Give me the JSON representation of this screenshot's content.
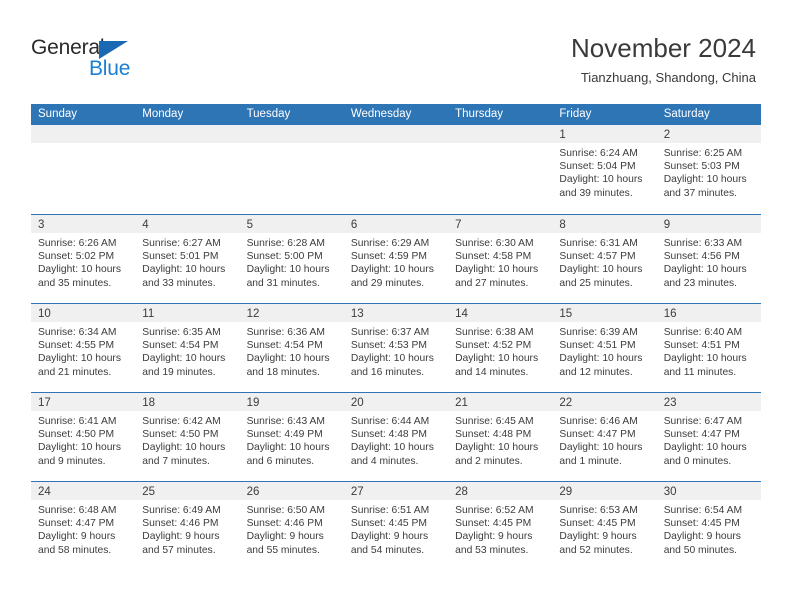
{
  "brand": {
    "name_part1": "General",
    "name_part2": "Blue",
    "triangle_color": "#1b68b3",
    "blue_color": "#1b7fd4"
  },
  "header": {
    "title": "November 2024",
    "subtitle": "Tianzhuang, Shandong, China"
  },
  "theme": {
    "header_row_bg": "#2e75b6",
    "day_band_bg": "#f0f0f0",
    "row_divider": "#2e75b6",
    "text": "#3c3c3c"
  },
  "weekdays": [
    "Sunday",
    "Monday",
    "Tuesday",
    "Wednesday",
    "Thursday",
    "Friday",
    "Saturday"
  ],
  "weeks": [
    [
      {
        "day": "",
        "empty": true,
        "sunrise": "",
        "sunset": "",
        "daylight_line1": "",
        "daylight_line2": ""
      },
      {
        "day": "",
        "empty": true,
        "sunrise": "",
        "sunset": "",
        "daylight_line1": "",
        "daylight_line2": ""
      },
      {
        "day": "",
        "empty": true,
        "sunrise": "",
        "sunset": "",
        "daylight_line1": "",
        "daylight_line2": ""
      },
      {
        "day": "",
        "empty": true,
        "sunrise": "",
        "sunset": "",
        "daylight_line1": "",
        "daylight_line2": ""
      },
      {
        "day": "",
        "empty": true,
        "sunrise": "",
        "sunset": "",
        "daylight_line1": "",
        "daylight_line2": ""
      },
      {
        "day": "1",
        "empty": false,
        "sunrise": "Sunrise: 6:24 AM",
        "sunset": "Sunset: 5:04 PM",
        "daylight_line1": "Daylight: 10 hours",
        "daylight_line2": "and 39 minutes."
      },
      {
        "day": "2",
        "empty": false,
        "sunrise": "Sunrise: 6:25 AM",
        "sunset": "Sunset: 5:03 PM",
        "daylight_line1": "Daylight: 10 hours",
        "daylight_line2": "and 37 minutes."
      }
    ],
    [
      {
        "day": "3",
        "empty": false,
        "sunrise": "Sunrise: 6:26 AM",
        "sunset": "Sunset: 5:02 PM",
        "daylight_line1": "Daylight: 10 hours",
        "daylight_line2": "and 35 minutes."
      },
      {
        "day": "4",
        "empty": false,
        "sunrise": "Sunrise: 6:27 AM",
        "sunset": "Sunset: 5:01 PM",
        "daylight_line1": "Daylight: 10 hours",
        "daylight_line2": "and 33 minutes."
      },
      {
        "day": "5",
        "empty": false,
        "sunrise": "Sunrise: 6:28 AM",
        "sunset": "Sunset: 5:00 PM",
        "daylight_line1": "Daylight: 10 hours",
        "daylight_line2": "and 31 minutes."
      },
      {
        "day": "6",
        "empty": false,
        "sunrise": "Sunrise: 6:29 AM",
        "sunset": "Sunset: 4:59 PM",
        "daylight_line1": "Daylight: 10 hours",
        "daylight_line2": "and 29 minutes."
      },
      {
        "day": "7",
        "empty": false,
        "sunrise": "Sunrise: 6:30 AM",
        "sunset": "Sunset: 4:58 PM",
        "daylight_line1": "Daylight: 10 hours",
        "daylight_line2": "and 27 minutes."
      },
      {
        "day": "8",
        "empty": false,
        "sunrise": "Sunrise: 6:31 AM",
        "sunset": "Sunset: 4:57 PM",
        "daylight_line1": "Daylight: 10 hours",
        "daylight_line2": "and 25 minutes."
      },
      {
        "day": "9",
        "empty": false,
        "sunrise": "Sunrise: 6:33 AM",
        "sunset": "Sunset: 4:56 PM",
        "daylight_line1": "Daylight: 10 hours",
        "daylight_line2": "and 23 minutes."
      }
    ],
    [
      {
        "day": "10",
        "empty": false,
        "sunrise": "Sunrise: 6:34 AM",
        "sunset": "Sunset: 4:55 PM",
        "daylight_line1": "Daylight: 10 hours",
        "daylight_line2": "and 21 minutes."
      },
      {
        "day": "11",
        "empty": false,
        "sunrise": "Sunrise: 6:35 AM",
        "sunset": "Sunset: 4:54 PM",
        "daylight_line1": "Daylight: 10 hours",
        "daylight_line2": "and 19 minutes."
      },
      {
        "day": "12",
        "empty": false,
        "sunrise": "Sunrise: 6:36 AM",
        "sunset": "Sunset: 4:54 PM",
        "daylight_line1": "Daylight: 10 hours",
        "daylight_line2": "and 18 minutes."
      },
      {
        "day": "13",
        "empty": false,
        "sunrise": "Sunrise: 6:37 AM",
        "sunset": "Sunset: 4:53 PM",
        "daylight_line1": "Daylight: 10 hours",
        "daylight_line2": "and 16 minutes."
      },
      {
        "day": "14",
        "empty": false,
        "sunrise": "Sunrise: 6:38 AM",
        "sunset": "Sunset: 4:52 PM",
        "daylight_line1": "Daylight: 10 hours",
        "daylight_line2": "and 14 minutes."
      },
      {
        "day": "15",
        "empty": false,
        "sunrise": "Sunrise: 6:39 AM",
        "sunset": "Sunset: 4:51 PM",
        "daylight_line1": "Daylight: 10 hours",
        "daylight_line2": "and 12 minutes."
      },
      {
        "day": "16",
        "empty": false,
        "sunrise": "Sunrise: 6:40 AM",
        "sunset": "Sunset: 4:51 PM",
        "daylight_line1": "Daylight: 10 hours",
        "daylight_line2": "and 11 minutes."
      }
    ],
    [
      {
        "day": "17",
        "empty": false,
        "sunrise": "Sunrise: 6:41 AM",
        "sunset": "Sunset: 4:50 PM",
        "daylight_line1": "Daylight: 10 hours",
        "daylight_line2": "and 9 minutes."
      },
      {
        "day": "18",
        "empty": false,
        "sunrise": "Sunrise: 6:42 AM",
        "sunset": "Sunset: 4:50 PM",
        "daylight_line1": "Daylight: 10 hours",
        "daylight_line2": "and 7 minutes."
      },
      {
        "day": "19",
        "empty": false,
        "sunrise": "Sunrise: 6:43 AM",
        "sunset": "Sunset: 4:49 PM",
        "daylight_line1": "Daylight: 10 hours",
        "daylight_line2": "and 6 minutes."
      },
      {
        "day": "20",
        "empty": false,
        "sunrise": "Sunrise: 6:44 AM",
        "sunset": "Sunset: 4:48 PM",
        "daylight_line1": "Daylight: 10 hours",
        "daylight_line2": "and 4 minutes."
      },
      {
        "day": "21",
        "empty": false,
        "sunrise": "Sunrise: 6:45 AM",
        "sunset": "Sunset: 4:48 PM",
        "daylight_line1": "Daylight: 10 hours",
        "daylight_line2": "and 2 minutes."
      },
      {
        "day": "22",
        "empty": false,
        "sunrise": "Sunrise: 6:46 AM",
        "sunset": "Sunset: 4:47 PM",
        "daylight_line1": "Daylight: 10 hours",
        "daylight_line2": "and 1 minute."
      },
      {
        "day": "23",
        "empty": false,
        "sunrise": "Sunrise: 6:47 AM",
        "sunset": "Sunset: 4:47 PM",
        "daylight_line1": "Daylight: 10 hours",
        "daylight_line2": "and 0 minutes."
      }
    ],
    [
      {
        "day": "24",
        "empty": false,
        "sunrise": "Sunrise: 6:48 AM",
        "sunset": "Sunset: 4:47 PM",
        "daylight_line1": "Daylight: 9 hours",
        "daylight_line2": "and 58 minutes."
      },
      {
        "day": "25",
        "empty": false,
        "sunrise": "Sunrise: 6:49 AM",
        "sunset": "Sunset: 4:46 PM",
        "daylight_line1": "Daylight: 9 hours",
        "daylight_line2": "and 57 minutes."
      },
      {
        "day": "26",
        "empty": false,
        "sunrise": "Sunrise: 6:50 AM",
        "sunset": "Sunset: 4:46 PM",
        "daylight_line1": "Daylight: 9 hours",
        "daylight_line2": "and 55 minutes."
      },
      {
        "day": "27",
        "empty": false,
        "sunrise": "Sunrise: 6:51 AM",
        "sunset": "Sunset: 4:45 PM",
        "daylight_line1": "Daylight: 9 hours",
        "daylight_line2": "and 54 minutes."
      },
      {
        "day": "28",
        "empty": false,
        "sunrise": "Sunrise: 6:52 AM",
        "sunset": "Sunset: 4:45 PM",
        "daylight_line1": "Daylight: 9 hours",
        "daylight_line2": "and 53 minutes."
      },
      {
        "day": "29",
        "empty": false,
        "sunrise": "Sunrise: 6:53 AM",
        "sunset": "Sunset: 4:45 PM",
        "daylight_line1": "Daylight: 9 hours",
        "daylight_line2": "and 52 minutes."
      },
      {
        "day": "30",
        "empty": false,
        "sunrise": "Sunrise: 6:54 AM",
        "sunset": "Sunset: 4:45 PM",
        "daylight_line1": "Daylight: 9 hours",
        "daylight_line2": "and 50 minutes."
      }
    ]
  ]
}
